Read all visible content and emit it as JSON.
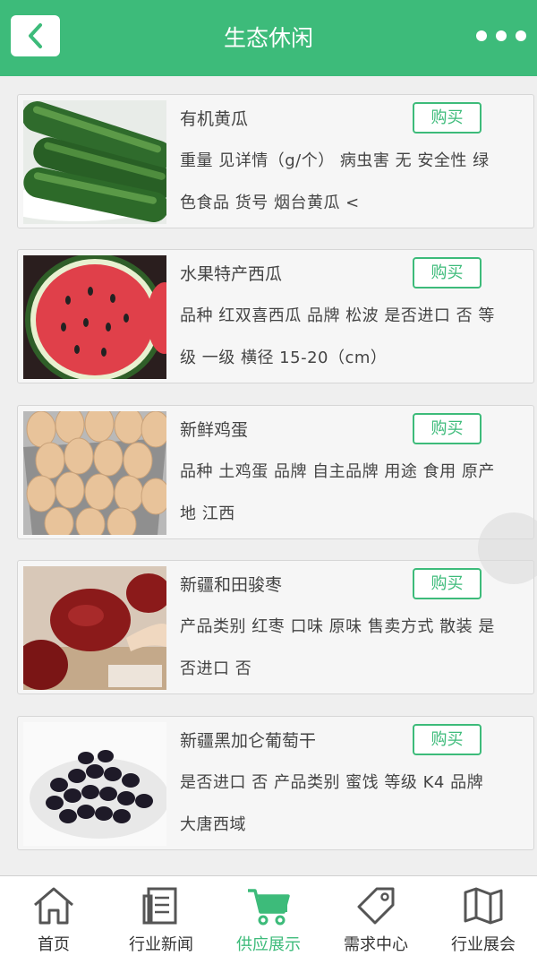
{
  "header": {
    "title": "生态休闲",
    "back_icon": "chevron-left-icon",
    "more_icon": "more-dots-icon"
  },
  "products": [
    {
      "name": "有机黄瓜",
      "buy_label": "购买",
      "desc": "重量 见详情（g/个） 病虫害 无 安全性 绿色食品 货号 烟台黄瓜 <",
      "image": "cucumber-image"
    },
    {
      "name": "水果特产西瓜",
      "buy_label": "购买",
      "desc": "品种 红双喜西瓜 品牌 松波 是否进口 否 等级 一级 横径 15-20（cm）",
      "image": "watermelon-image"
    },
    {
      "name": "新鲜鸡蛋",
      "buy_label": "购买",
      "desc": "品种 土鸡蛋 品牌 自主品牌 用途 食用 原产地 江西",
      "image": "eggs-image"
    },
    {
      "name": "新疆和田骏枣",
      "buy_label": "购买",
      "desc": "产品类别 红枣 口味 原味 售卖方式 散装 是否进口 否",
      "image": "jujube-image"
    },
    {
      "name": "新疆黑加仑葡萄干",
      "buy_label": "购买",
      "desc": "是否进口 否 产品类别 蜜饯 等级 K4 品牌 大唐西域",
      "image": "raisins-image"
    }
  ],
  "tabbar": {
    "tabs": [
      {
        "label": "首页",
        "icon": "home-icon"
      },
      {
        "label": "行业新闻",
        "icon": "news-icon"
      },
      {
        "label": "供应展示",
        "icon": "cart-icon",
        "active": true
      },
      {
        "label": "需求中心",
        "icon": "tag-icon"
      },
      {
        "label": "行业展会",
        "icon": "map-icon"
      }
    ]
  },
  "colors": {
    "brand": "#3dbb7a",
    "background": "#efefef"
  }
}
